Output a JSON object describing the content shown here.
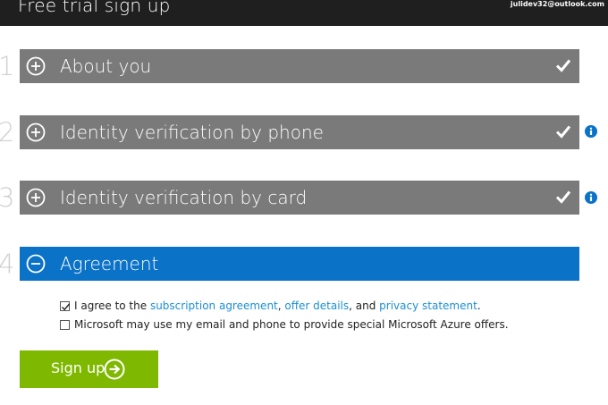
{
  "header": {
    "title": "Free trial sign up",
    "user_email": "julidev32@outlook.com"
  },
  "steps": [
    {
      "number": "1",
      "label": "About you",
      "state": "completed",
      "icon": "plus-circle-icon"
    },
    {
      "number": "2",
      "label": "Identity verification by phone",
      "state": "completed",
      "icon": "plus-circle-icon"
    },
    {
      "number": "3",
      "label": "Identity verification by card",
      "state": "completed",
      "icon": "plus-circle-icon"
    },
    {
      "number": "4",
      "label": "Agreement",
      "state": "active",
      "icon": "minus-circle-icon"
    }
  ],
  "agreement": {
    "terms": {
      "checked": true,
      "prefix": "I agree to the ",
      "link_subscription": "subscription agreement",
      "comma": ", ",
      "link_offer": "offer details",
      "and_text": ", and ",
      "link_privacy": "privacy statement",
      "suffix": "."
    },
    "offers": {
      "checked": false,
      "label": "Microsoft may use my email and phone to provide special Microsoft Azure offers."
    }
  },
  "signup_button": {
    "label": "Sign up",
    "icon": "arrow-right-circle-icon"
  },
  "colors": {
    "topbar": "#1f1f1f",
    "section_collapsed": "#7a7a7a",
    "section_active": "#0a72c7",
    "link": "#1b8fd6",
    "info_icon": "#0a72c7",
    "signup": "#7fb800"
  }
}
